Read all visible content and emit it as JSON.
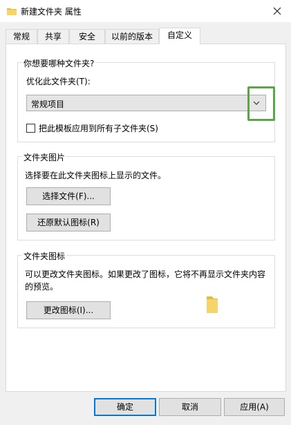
{
  "window": {
    "title": "新建文件夹 属性",
    "close_icon": "close-icon",
    "folder_icon": "folder-icon"
  },
  "tabs": [
    {
      "label": "常规"
    },
    {
      "label": "共享"
    },
    {
      "label": "安全"
    },
    {
      "label": "以前的版本"
    },
    {
      "label": "自定义",
      "active": true
    }
  ],
  "optimize": {
    "group_title": "你想要哪种文件夹?",
    "label": "优化此文件夹(T):",
    "selected": "常规项目",
    "apply_subfolders": "把此模板应用到所有子文件夹(S)",
    "apply_subfolders_checked": false
  },
  "folder_pictures": {
    "group_title": "文件夹图片",
    "description": "选择要在此文件夹图标上显示的文件。",
    "choose_file": "选择文件(F)...",
    "restore_default": "还原默认图标(R)"
  },
  "folder_icons": {
    "group_title": "文件夹图标",
    "description_line1": "可以更改文件夹图标。如果更改了图标，它将不再显示文件夹内容",
    "description_line2": "的预览。",
    "change_icon": "更改图标(I)..."
  },
  "footer": {
    "ok": "确定",
    "cancel": "取消",
    "apply": "应用(A)"
  },
  "colors": {
    "highlight": "#5aa44a",
    "folder": "#f6d46c",
    "accent": "#0078d7"
  }
}
